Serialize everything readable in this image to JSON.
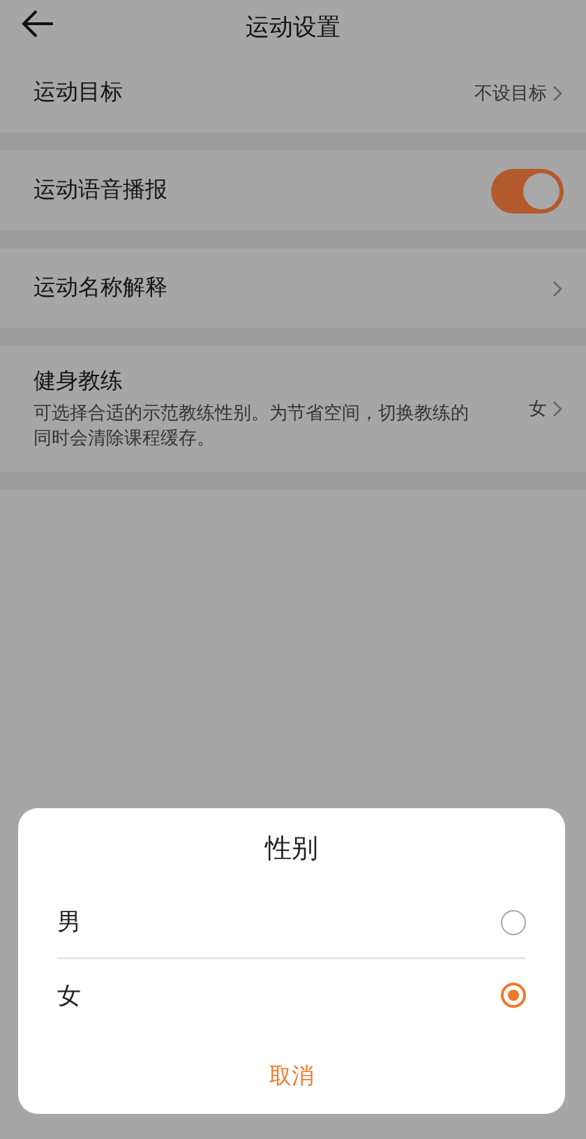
{
  "header": {
    "title": "运动设置"
  },
  "settings": [
    {
      "kind": "link",
      "label": "运动目标",
      "value": "不设目标"
    },
    {
      "kind": "toggle",
      "label": "运动语音播报",
      "on": true
    },
    {
      "kind": "link",
      "label": "运动名称解释"
    },
    {
      "kind": "link",
      "label": "健身教练",
      "description": "可选择合适的示范教练性别。为节省空间，切换教练的同时会清除课程缓存。",
      "value": "女"
    }
  ],
  "dialog": {
    "title": "性别",
    "options": [
      {
        "label": "男",
        "selected": false
      },
      {
        "label": "女",
        "selected": true
      }
    ],
    "cancel": "取消"
  }
}
